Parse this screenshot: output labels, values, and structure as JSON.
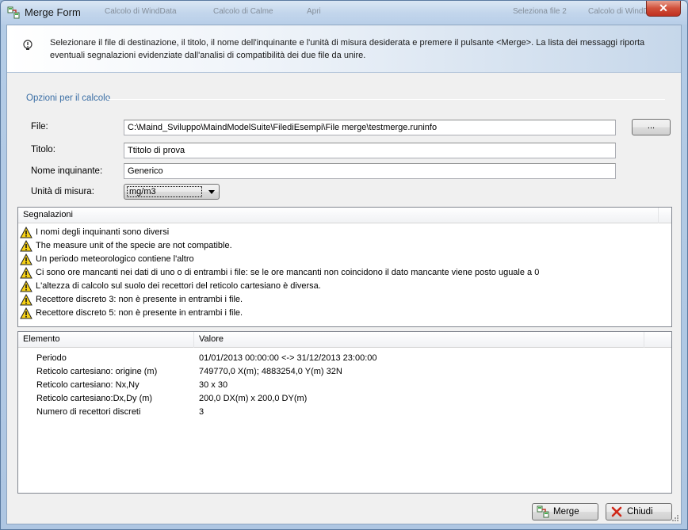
{
  "window": {
    "title": "Merge Form",
    "close_glyph": "✕",
    "background_tabs": [
      "Calcolo di WindData",
      "Calcolo di Calme",
      "Apri",
      "Seleziona file 2",
      "Calcolo di WindData"
    ]
  },
  "header": {
    "text": "Selezionare il file di destinazione, il titolo, il nome dell'inquinante e l'unità di misura desiderata e premere il pulsante <Merge>. La lista dei messaggi riporta eventuali segnalazioni evidenziate dall'analisi di compatibilità dei due file da unire."
  },
  "options": {
    "group_title": "Opzioni per il calcolo",
    "file_label": "File:",
    "file_value": "C:\\Maind_Sviluppo\\MaindModelSuite\\FilediEsempi\\File merge\\testmerge.runinfo",
    "browse_label": "...",
    "title_label": "Titolo:",
    "title_value": "Ttitolo di prova",
    "pollutant_label": "Nome inquinante:",
    "pollutant_value": "Generico",
    "unit_label": "Unità di misura:",
    "unit_value": "mg/m3"
  },
  "messages": {
    "header": "Segnalazioni",
    "items": [
      "I nomi degli inquinanti sono diversi",
      "The measure unit of the specie are not compatible.",
      "Un periodo meteorologico contiene l'altro",
      "Ci sono ore mancanti nei dati di uno o di entrambi i file: se le ore mancanti non coincidono il dato mancante viene posto uguale a 0",
      "L'altezza di calcolo sul suolo dei recettori del reticolo cartesiano è diversa.",
      "Recettore discreto 3: non è presente in entrambi i file.",
      "Recettore discreto 5: non è presente in entrambi i file."
    ]
  },
  "details": {
    "columns": [
      "Elemento",
      "Valore"
    ],
    "rows": [
      {
        "element": "Periodo",
        "value": "01/01/2013 00:00:00 <-> 31/12/2013 23:00:00"
      },
      {
        "element": "Reticolo cartesiano: origine (m)",
        "value": "749770,0 X(m); 4883254,0 Y(m) 32N"
      },
      {
        "element": "Reticolo cartesiano: Nx,Ny",
        "value": "30 x 30"
      },
      {
        "element": "Reticolo cartesiano:Dx,Dy (m)",
        "value": "200,0 DX(m) x 200,0 DY(m)"
      },
      {
        "element": "Numero di recettori discreti",
        "value": "3"
      }
    ]
  },
  "buttons": {
    "merge_label": "Merge",
    "close_label": "Chiudi"
  },
  "icons": {
    "app": "merge-form-icon",
    "info": "info-bulb-icon",
    "warning": "warning-triangle-icon",
    "merge": "merge-icon",
    "close": "red-x-icon"
  },
  "colors": {
    "group_title": "#3a6ea5",
    "warning_fill": "#f7d117",
    "close_button": "#c03020"
  }
}
